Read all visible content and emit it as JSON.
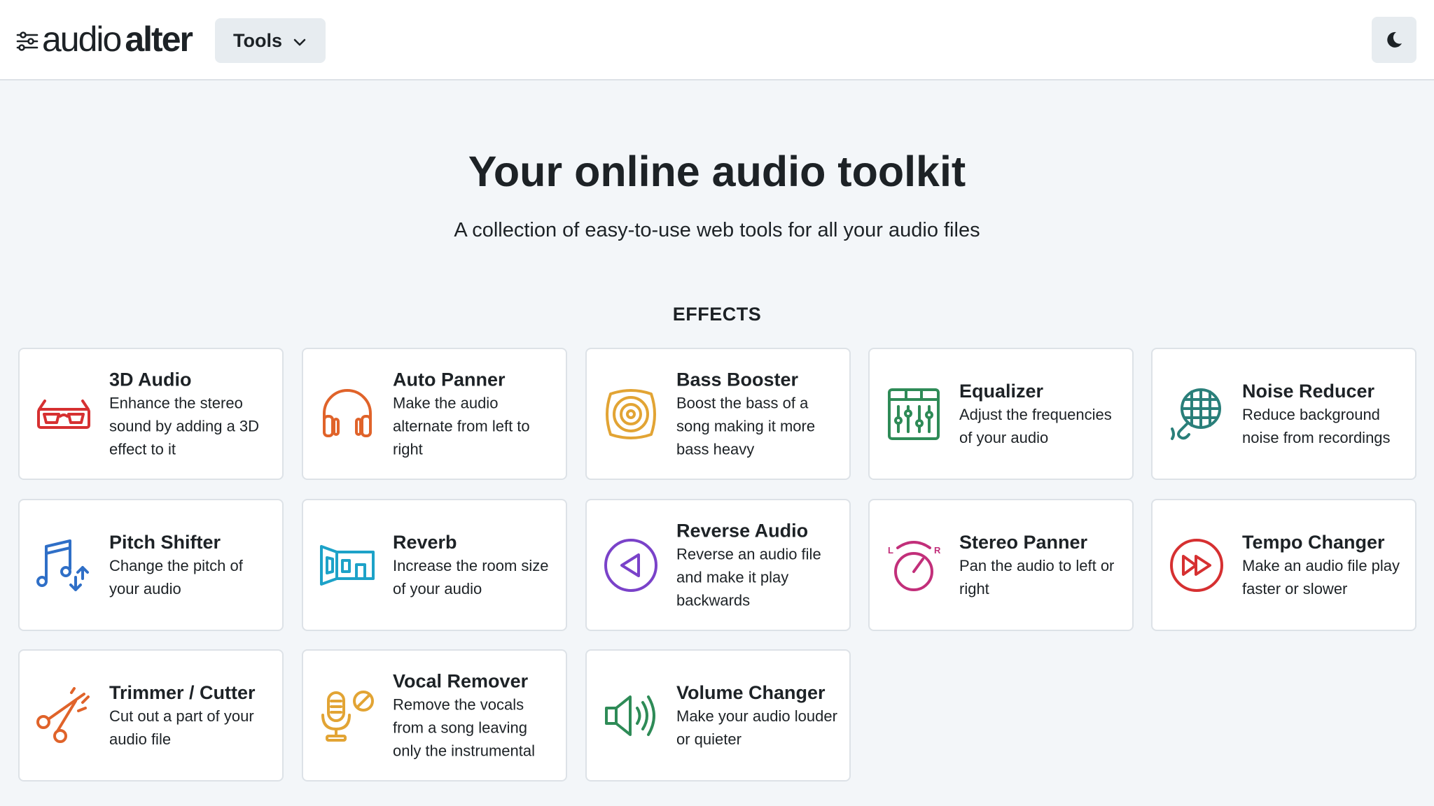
{
  "header": {
    "logo_word1": "audio",
    "logo_word2": "alter",
    "tools_label": "Tools"
  },
  "hero": {
    "title": "Your online audio toolkit",
    "subtitle": "A collection of easy-to-use web tools for all your audio files"
  },
  "section_title": "EFFECTS",
  "cards": [
    {
      "title": "3D Audio",
      "desc": "Enhance the stereo sound by adding a 3D effect to it",
      "icon": "3d-glasses-icon",
      "color": "#d63031"
    },
    {
      "title": "Auto Panner",
      "desc": "Make the audio alternate from left to right",
      "icon": "headphones-icon",
      "color": "#e0632a"
    },
    {
      "title": "Bass Booster",
      "desc": "Boost the bass of a song making it more bass heavy",
      "icon": "speaker-icon",
      "color": "#e2a434"
    },
    {
      "title": "Equalizer",
      "desc": "Adjust the frequencies of your audio",
      "icon": "equalizer-icon",
      "color": "#2e8b57"
    },
    {
      "title": "Noise Reducer",
      "desc": "Reduce background noise from recordings",
      "icon": "grid-microphone-icon",
      "color": "#2a7f7a"
    },
    {
      "title": "Pitch Shifter",
      "desc": "Change the pitch of your audio",
      "icon": "music-notes-icon",
      "color": "#2f6fc7"
    },
    {
      "title": "Reverb",
      "desc": "Increase the room size of your audio",
      "icon": "room-icon",
      "color": "#1da2c8"
    },
    {
      "title": "Reverse Audio",
      "desc": "Reverse an audio file and make it play backwards",
      "icon": "reverse-play-icon",
      "color": "#7a42c9"
    },
    {
      "title": "Stereo Panner",
      "desc": "Pan the audio to left or right",
      "icon": "pan-knob-icon",
      "color": "#c22f7a"
    },
    {
      "title": "Tempo Changer",
      "desc": "Make an audio file play faster or slower",
      "icon": "fast-forward-icon",
      "color": "#d63031"
    },
    {
      "title": "Trimmer / Cutter",
      "desc": "Cut out a part of your audio file",
      "icon": "scissors-icon",
      "color": "#e0632a"
    },
    {
      "title": "Vocal Remover",
      "desc": "Remove the vocals from a song leaving only the instrumental",
      "icon": "no-mic-icon",
      "color": "#e2a434"
    },
    {
      "title": "Volume Changer",
      "desc": "Make your audio louder or quieter",
      "icon": "volume-icon",
      "color": "#2e8b57"
    }
  ]
}
